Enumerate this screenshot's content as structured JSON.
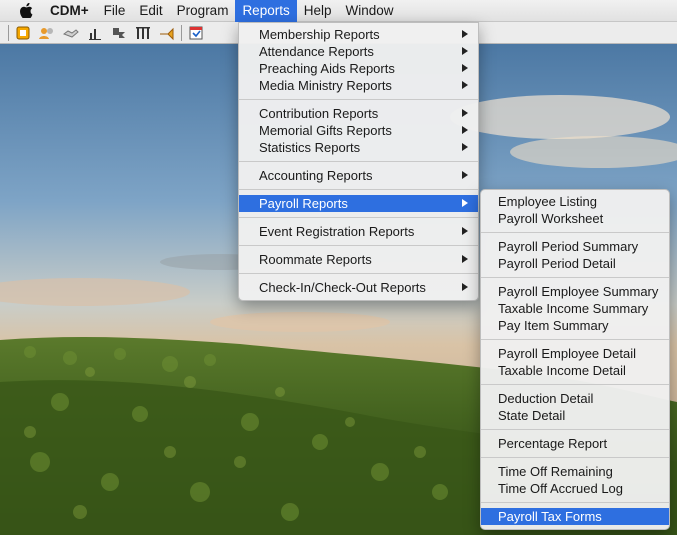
{
  "menubar": {
    "apple_icon": "apple-logo-icon",
    "items": [
      {
        "label": "CDM+"
      },
      {
        "label": "File"
      },
      {
        "label": "Edit"
      },
      {
        "label": "Program"
      },
      {
        "label": "Reports"
      },
      {
        "label": "Help"
      },
      {
        "label": "Window"
      }
    ],
    "active_color": "#2e6fe0"
  },
  "toolbar": {
    "buttons": [
      "home-icon",
      "people-icon",
      "handshake-icon",
      "chart-icon",
      "move-icon",
      "columns-icon",
      "trumpet-icon",
      "calendar-icon"
    ]
  },
  "reports_menu": {
    "groups": [
      [
        "Membership Reports",
        "Attendance Reports",
        "Preaching Aids Reports",
        "Media Ministry Reports"
      ],
      [
        "Contribution Reports",
        "Memorial Gifts Reports",
        "Statistics Reports"
      ],
      [
        "Accounting Reports"
      ],
      [
        "Payroll Reports"
      ],
      [
        "Event Registration Reports"
      ],
      [
        "Roommate Reports"
      ],
      [
        "Check-In/Check-Out Reports"
      ]
    ],
    "highlighted": "Payroll Reports"
  },
  "payroll_menu": {
    "groups": [
      [
        "Employee Listing",
        "Payroll Worksheet"
      ],
      [
        "Payroll Period Summary",
        "Payroll Period Detail"
      ],
      [
        "Payroll Employee Summary",
        "Taxable Income Summary",
        "Pay Item Summary"
      ],
      [
        "Payroll Employee Detail",
        "Taxable Income Detail"
      ],
      [
        "Deduction Detail",
        "State Detail"
      ],
      [
        "Percentage Report"
      ],
      [
        "Time Off Remaining",
        "Time Off Accrued Log"
      ],
      [
        "Payroll Tax Forms"
      ]
    ],
    "highlighted": "Payroll Tax Forms"
  }
}
